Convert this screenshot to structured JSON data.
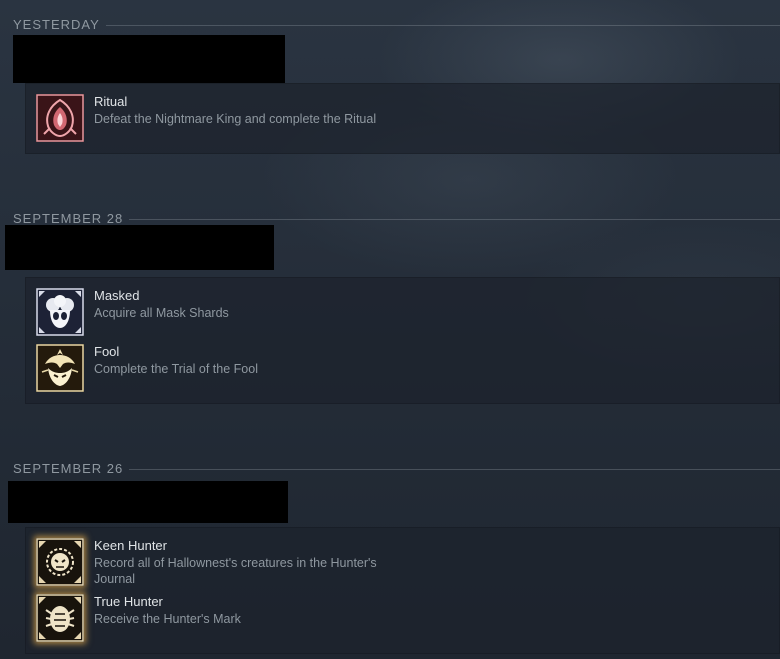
{
  "sections": [
    {
      "date": "YESTERDAY",
      "achievements": [
        {
          "title": "Ritual",
          "description": "Defeat the Nightmare King and complete the Ritual",
          "icon": "ritual-icon"
        }
      ]
    },
    {
      "date": "SEPTEMBER 28",
      "achievements": [
        {
          "title": "Masked",
          "description": "Acquire all Mask Shards",
          "icon": "mask-icon"
        },
        {
          "title": "Fool",
          "description": "Complete the Trial of the Fool",
          "icon": "fool-icon"
        }
      ]
    },
    {
      "date": "SEPTEMBER 26",
      "achievements": [
        {
          "title": "Keen Hunter",
          "description": "Record all of Hallownest's creatures in the Hunter's Journal",
          "icon": "keen-hunter-icon"
        },
        {
          "title": "True Hunter",
          "description": "Receive the Hunter's Mark",
          "icon": "true-hunter-icon"
        }
      ]
    }
  ],
  "colors": {
    "background": "#262f3b",
    "card": "#1c222c",
    "title_text": "#dfe3e6",
    "desc_text": "#8f98a0",
    "redaction": "#000000",
    "hunter_glow": "#d6a24a"
  }
}
